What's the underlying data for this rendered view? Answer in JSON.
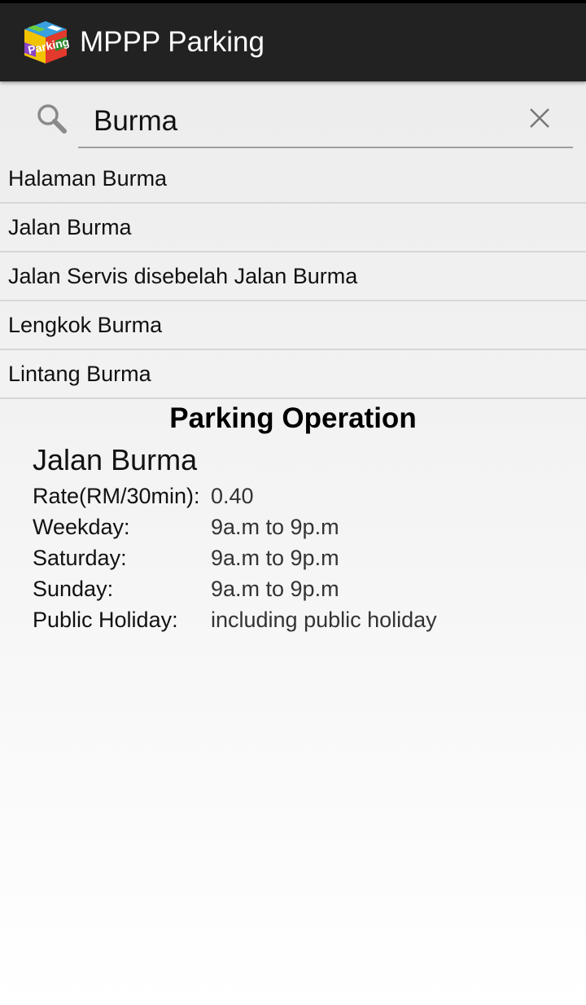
{
  "app": {
    "title": "MPPP Parking",
    "icon": "parking-cube-logo-icon",
    "bar_color": "#222222"
  },
  "search": {
    "value": "Burma",
    "placeholder": ""
  },
  "suggestions": [
    "Halaman Burma",
    "Jalan Burma",
    "Jalan Servis disebelah Jalan Burma",
    "Lengkok Burma",
    "Lintang Burma"
  ],
  "detail": {
    "section_title": "Parking Operation",
    "name": "Jalan Burma",
    "rows": [
      {
        "label": "Rate(RM/30min):",
        "value": "0.40"
      },
      {
        "label": "Weekday:",
        "value": "9a.m to 9p.m"
      },
      {
        "label": "Saturday:",
        "value": "9a.m to 9p.m"
      },
      {
        "label": "Sunday:",
        "value": "9a.m to 9p.m"
      },
      {
        "label": "Public Holiday:",
        "value": "including public holiday"
      }
    ]
  }
}
